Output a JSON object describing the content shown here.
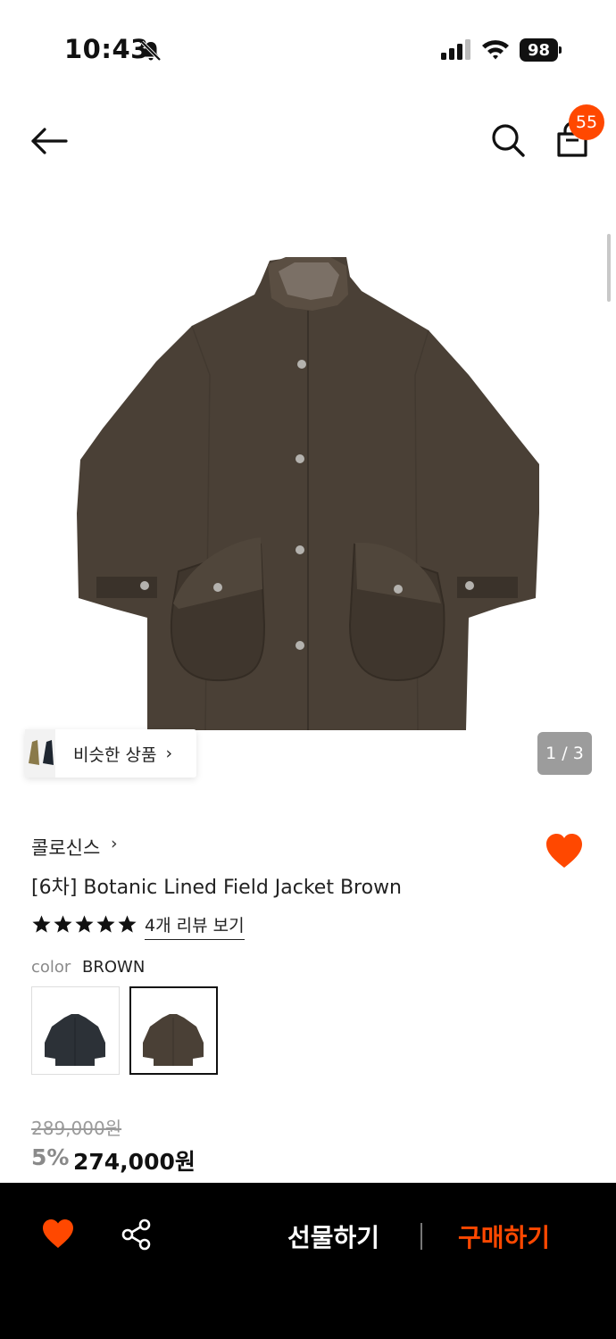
{
  "status_bar": {
    "time": "10:43",
    "battery": "98",
    "icons": [
      "bell-slash-icon",
      "cellular-signal-icon",
      "wifi-icon",
      "battery-icon"
    ]
  },
  "header": {
    "icons": [
      "back-arrow-icon",
      "search-icon",
      "shopping-bag-icon"
    ],
    "cart_count": "55"
  },
  "gallery": {
    "counter": "1 / 3",
    "similar_label": "비슷한 상품"
  },
  "product": {
    "brand": "콜로신스",
    "title": "[6차] Botanic Lined Field Jacket Brown",
    "rating_stars": 5,
    "review_link": "4개 리뷰 보기",
    "color_key": "color",
    "color_value": "BROWN",
    "original_price": "289,000원",
    "discount_rate": "5%",
    "sale_price": "274,000원"
  },
  "bottom_bar": {
    "gift_label": "선물하기",
    "buy_label": "구매하기"
  },
  "colors": {
    "accent": "#ff4800",
    "jacket_brown": "#4a4036",
    "jacket_navy": "#2c3137"
  }
}
